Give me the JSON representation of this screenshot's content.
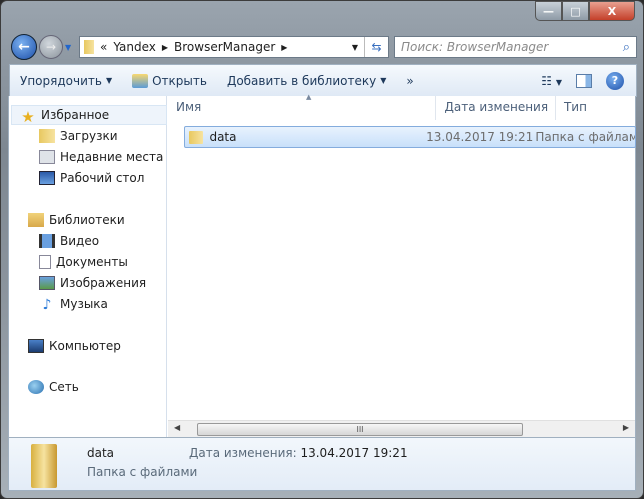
{
  "window": {
    "minimize": "—",
    "maximize": "□",
    "close": "X"
  },
  "address": {
    "overflow": "«",
    "segments": [
      "Yandex",
      "BrowserManager"
    ],
    "refresh": "⇆"
  },
  "search": {
    "placeholder": "Поиск: BrowserManager",
    "icon": "⌕"
  },
  "toolbar": {
    "organize": "Упорядочить",
    "open": "Открыть",
    "add_to_library": "Добавить в библиотеку",
    "more": "»",
    "help": "?"
  },
  "sidebar": {
    "favorites": {
      "label": "Избранное",
      "items": [
        "Загрузки",
        "Недавние места",
        "Рабочий стол"
      ]
    },
    "libraries": {
      "label": "Библиотеки",
      "items": [
        "Видео",
        "Документы",
        "Изображения",
        "Музыка"
      ]
    },
    "computer": "Компьютер",
    "network": "Сеть"
  },
  "columns": [
    "Имя",
    "Дата изменения",
    "Тип"
  ],
  "files": [
    {
      "name": "data",
      "date": "13.04.2017 19:21",
      "type": "Папка с файлами"
    }
  ],
  "details": {
    "name": "data",
    "type": "Папка с файлами",
    "date_label": "Дата изменения:",
    "date": "13.04.2017 19:21"
  }
}
